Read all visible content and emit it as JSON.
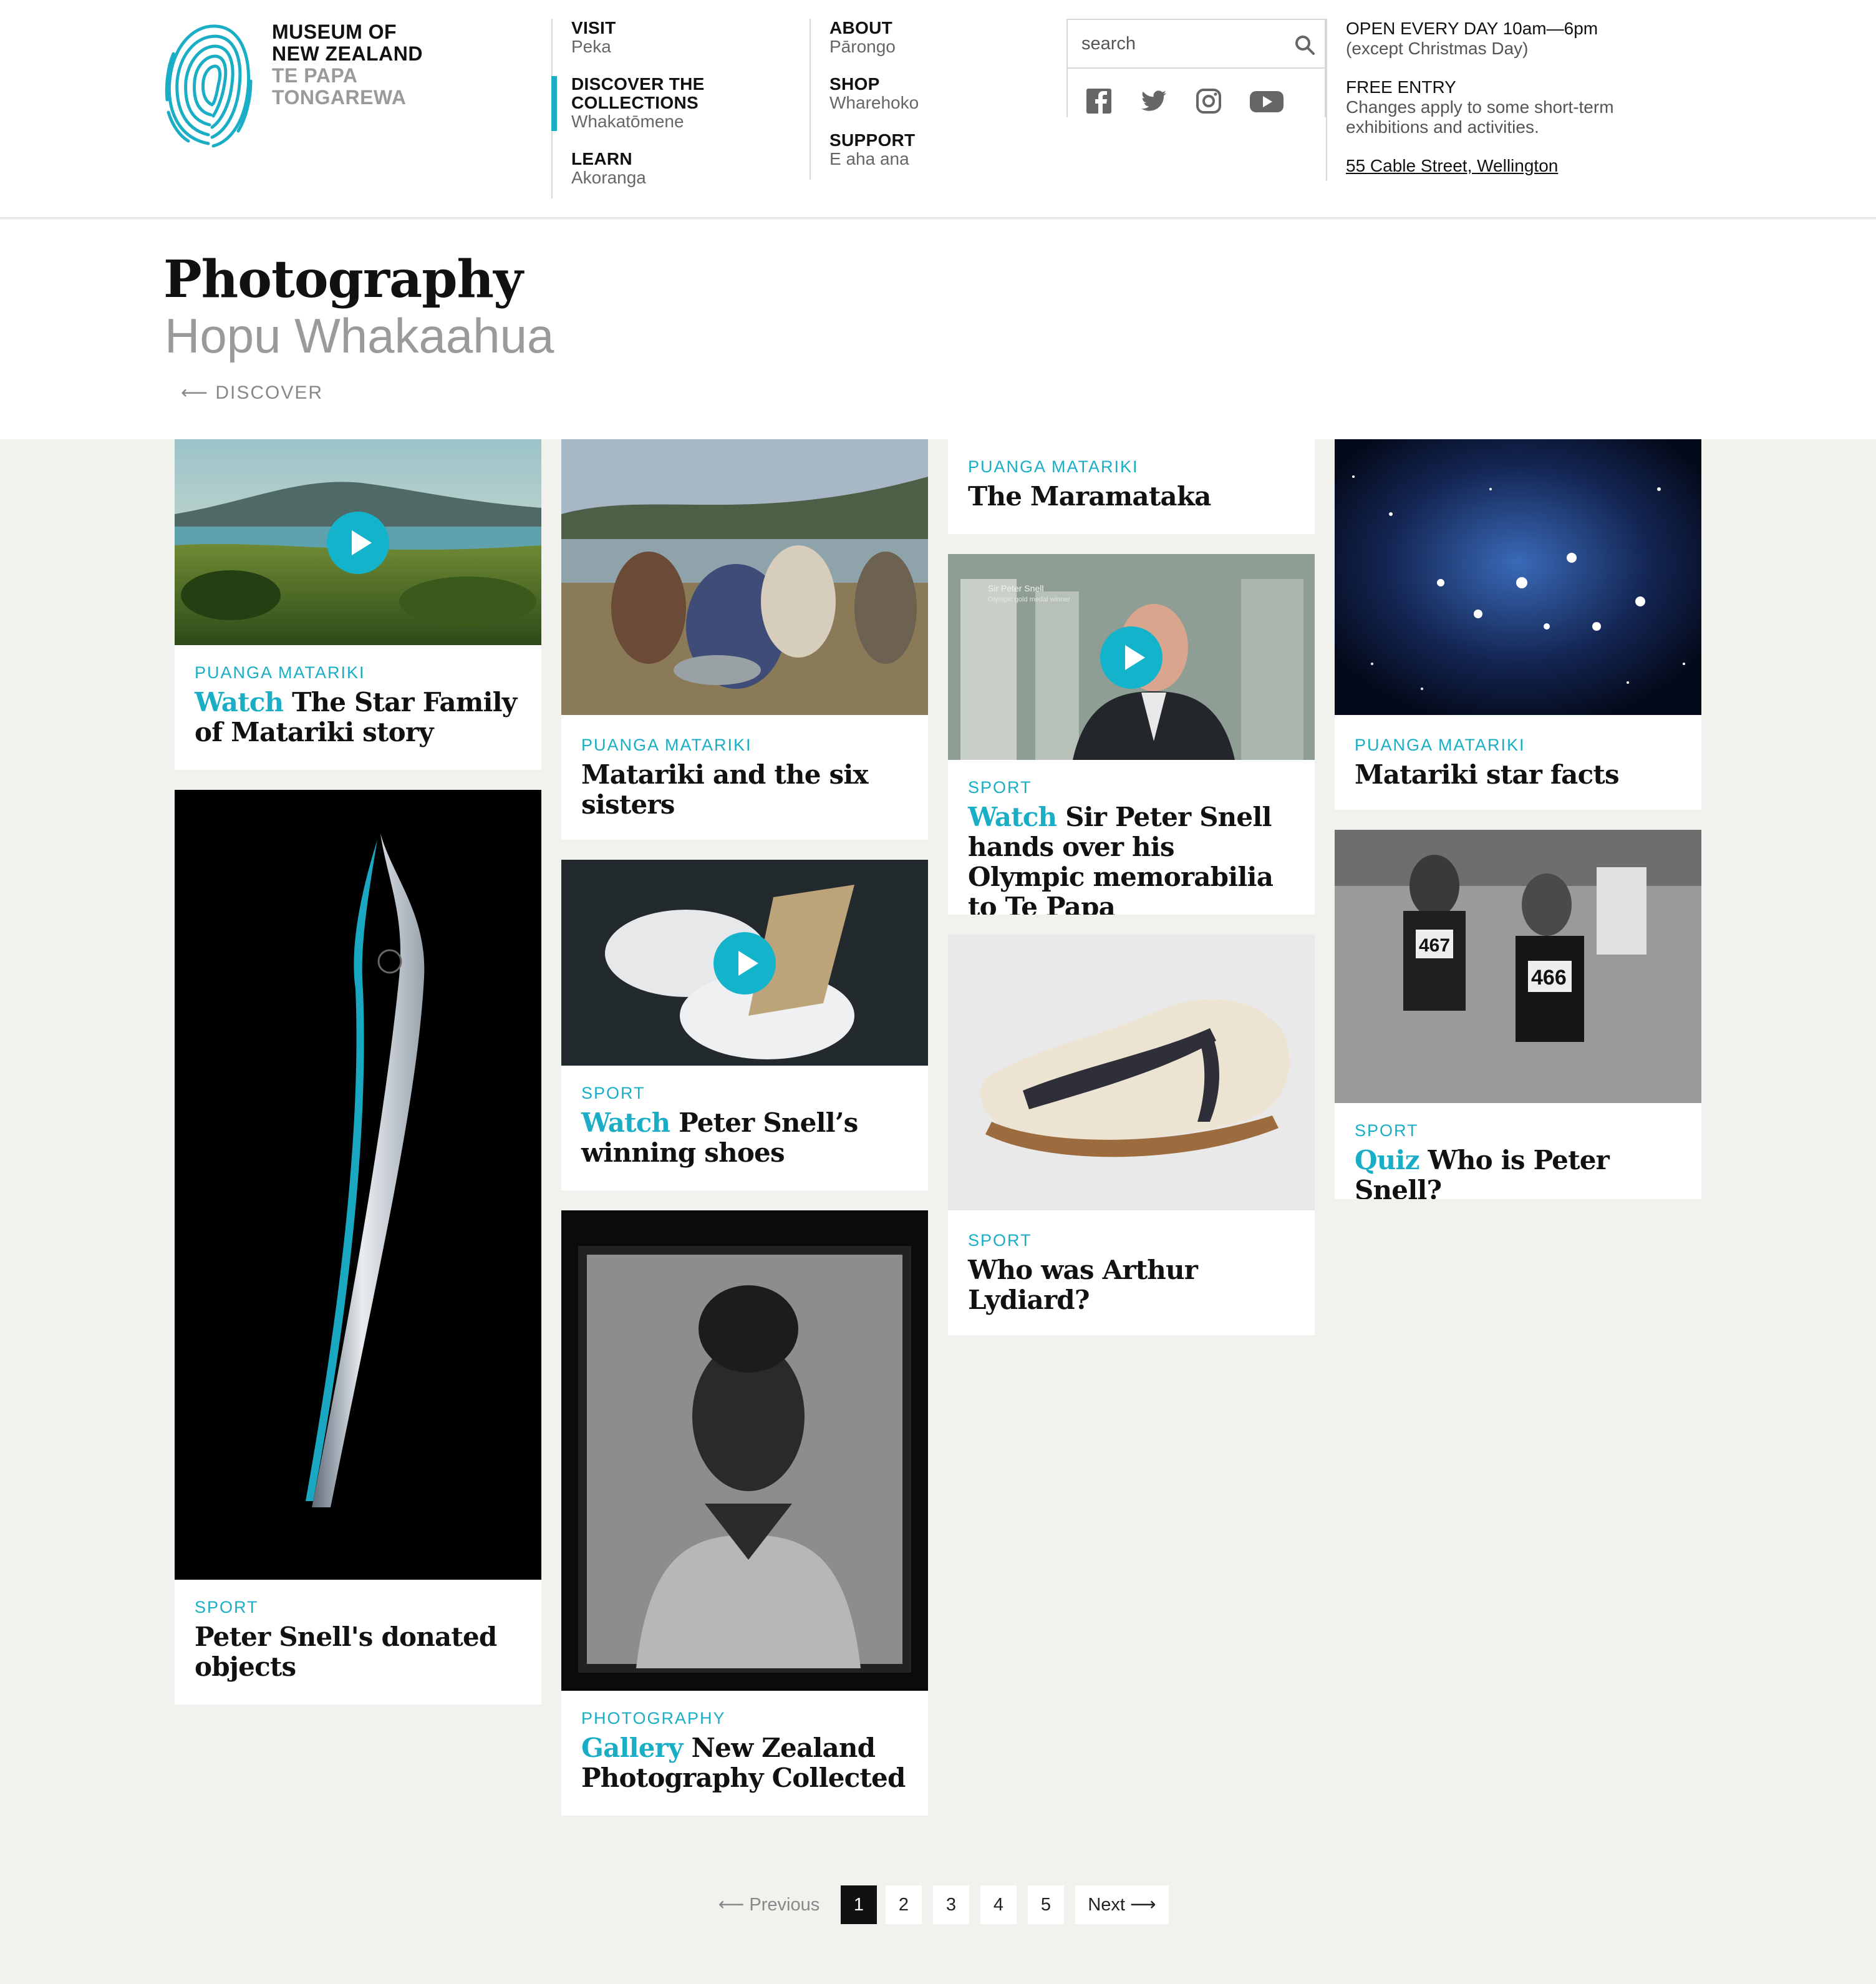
{
  "brand": {
    "line1": "MUSEUM OF",
    "line2": "NEW ZEALAND",
    "line3": "TE PAPA",
    "line4": "TONGAREWA",
    "accent": "#1aaec6"
  },
  "nav": {
    "col1": [
      {
        "en": "VISIT",
        "mi": "Peka"
      },
      {
        "en": "DISCOVER THE COLLECTIONS",
        "en_line1": "DISCOVER THE",
        "en_line2": "COLLECTIONS",
        "mi": "Whakatōmene"
      },
      {
        "en": "LEARN",
        "mi": "Akoranga"
      }
    ],
    "col2": [
      {
        "en": "ABOUT",
        "mi": "Pārongo"
      },
      {
        "en": "SHOP",
        "mi": "Wharehoko"
      },
      {
        "en": "SUPPORT",
        "mi": "E aha ana"
      }
    ]
  },
  "search": {
    "placeholder": "search"
  },
  "social": [
    "facebook-icon",
    "twitter-icon",
    "instagram-icon",
    "youtube-icon"
  ],
  "info": {
    "hours": "OPEN EVERY DAY 10am—6pm",
    "hours_note": "(except Christmas Day)",
    "entry": "FREE ENTRY",
    "entry_note_1": "Changes apply to some short-term",
    "entry_note_2": "exhibitions and activities.",
    "address": "55 Cable Street, Wellington"
  },
  "page": {
    "title": "Photography",
    "subtitle": "Hopu Whakaahua",
    "back": "⟵ DISCOVER"
  },
  "cards": {
    "c1": {
      "category": "PUANGA MATARIKI",
      "prefix": "Watch",
      "title": " The Star Family of Matariki story"
    },
    "c2": {
      "category": "SPORT",
      "prefix": "",
      "title": " Peter Snell's donated objects"
    },
    "c3": {
      "category": "PUANGA MATARIKI",
      "prefix": "",
      "title": "Matariki and the six sisters"
    },
    "c4": {
      "category": "SPORT",
      "prefix": "Watch",
      "title": " Peter Snell’s winning shoes"
    },
    "c5": {
      "category": "PHOTOGRAPHY",
      "prefix": "Gallery",
      "title": " New Zealand Photography Collected"
    },
    "c6": {
      "category": "PUANGA MATARIKI",
      "prefix": "",
      "title": "The Maramataka"
    },
    "c7": {
      "category": "SPORT",
      "prefix": "Watch",
      "title": " Sir Peter Snell hands over his Olympic memorabilia to Te Papa",
      "video_caption_1": "Sir Peter Snell",
      "video_caption_2": "Olympic gold medal winner"
    },
    "c8": {
      "category": "SPORT",
      "prefix": "",
      "title": " Who was Arthur Lydiard?"
    },
    "c9": {
      "category": "PUANGA MATARIKI",
      "prefix": "",
      "title": "Matariki star facts"
    },
    "c10": {
      "category": "SPORT",
      "prefix": "Quiz",
      "title": " Who is Peter Snell?",
      "bib1": "467",
      "bib2": "466"
    }
  },
  "pagination": {
    "prev": "⟵ Previous",
    "pages": [
      "1",
      "2",
      "3",
      "4",
      "5"
    ],
    "current": "1",
    "next": "Next ⟶"
  }
}
